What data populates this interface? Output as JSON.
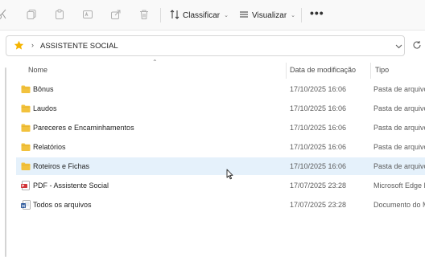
{
  "toolbar": {
    "icons": [
      "cut-icon",
      "copy-icon",
      "paste-icon",
      "rename-icon",
      "share-icon",
      "delete-icon"
    ],
    "sort_label": "Classificar",
    "view_label": "Visualizar",
    "more_label": "•••"
  },
  "address": {
    "crumb_separator": "›",
    "current_folder": "ASSISTENTE SOCIAL"
  },
  "columns": {
    "name": "Nome",
    "date": "Data de modificação",
    "type": "Tipo"
  },
  "files": [
    {
      "name": "Bônus",
      "date": "17/10/2025 16:06",
      "type": "Pasta de arquivos",
      "icon": "folder-icon",
      "selected": false
    },
    {
      "name": "Laudos",
      "date": "17/10/2025 16:06",
      "type": "Pasta de arquivos",
      "icon": "folder-icon",
      "selected": false
    },
    {
      "name": "Pareceres e Encaminhamentos",
      "date": "17/10/2025 16:06",
      "type": "Pasta de arquivos",
      "icon": "folder-icon",
      "selected": false
    },
    {
      "name": "Relatórios",
      "date": "17/10/2025 16:06",
      "type": "Pasta de arquivos",
      "icon": "folder-icon",
      "selected": false
    },
    {
      "name": "Roteiros e Fichas",
      "date": "17/10/2025 16:06",
      "type": "Pasta de arquivos",
      "icon": "folder-icon",
      "selected": true
    },
    {
      "name": "PDF - Assistente Social",
      "date": "17/07/2025 23:28",
      "type": "Microsoft Edge PDF Document",
      "icon": "pdf-icon",
      "selected": false
    },
    {
      "name": "Todos os arquivos",
      "date": "17/07/2025 23:28",
      "type": "Documento do Microsoft Word",
      "icon": "word-doc-icon",
      "selected": false
    }
  ],
  "colors": {
    "folder": "#f2c23d",
    "selected_row": "#e5f1fb",
    "star": "#f5b400",
    "pdf": "#d13438",
    "word": "#2b579a"
  }
}
